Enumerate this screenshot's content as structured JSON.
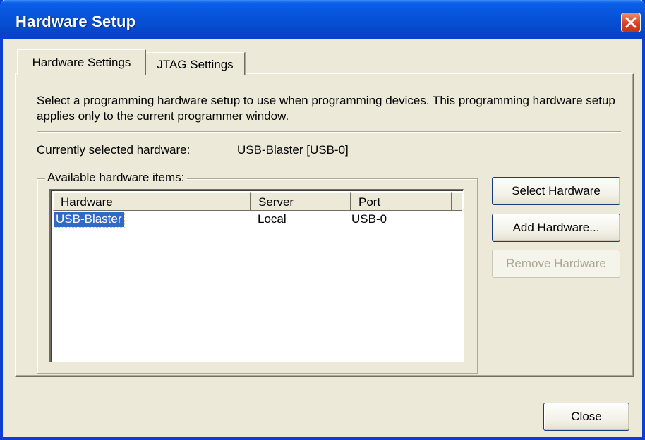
{
  "window": {
    "title": "Hardware Setup"
  },
  "tabs": [
    {
      "label": "Hardware Settings",
      "active": true
    },
    {
      "label": "JTAG Settings",
      "active": false
    }
  ],
  "panel": {
    "description": "Select a programming hardware setup to use when programming devices. This programming hardware setup applies only to the current programmer window.",
    "current_label": "Currently selected hardware:",
    "current_value": "USB-Blaster [USB-0]",
    "group_label": "Available hardware items:",
    "columns": [
      "Hardware",
      "Server",
      "Port"
    ],
    "rows": [
      {
        "hardware": "USB-Blaster",
        "server": "Local",
        "port": "USB-0",
        "selected": true
      }
    ]
  },
  "buttons": {
    "select": "Select Hardware",
    "add": "Add Hardware...",
    "remove": "Remove Hardware",
    "close": "Close"
  },
  "icons": {
    "close": "close-icon"
  },
  "colors": {
    "titlebar": "#0652d8",
    "selection": "#316ac5",
    "dialog_bg": "#ece9d8"
  }
}
